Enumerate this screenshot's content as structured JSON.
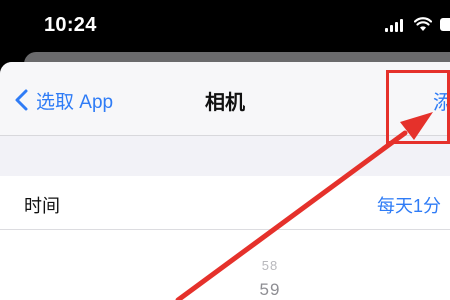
{
  "status_bar": {
    "time": "10:24"
  },
  "nav": {
    "back_label": "选取 App",
    "title": "相机",
    "add_label": "添"
  },
  "time_row": {
    "label": "时间",
    "value": "每天1分"
  },
  "picker": {
    "faint_value": "58",
    "value": "59"
  },
  "colors": {
    "accent": "#2f7cf6",
    "annotation": "#e5312b",
    "background": "#f2f2f7"
  },
  "icons": [
    "cellular-signal-icon",
    "wifi-icon",
    "battery-icon",
    "chevron-left-icon",
    "red-arrow-annotation"
  ]
}
